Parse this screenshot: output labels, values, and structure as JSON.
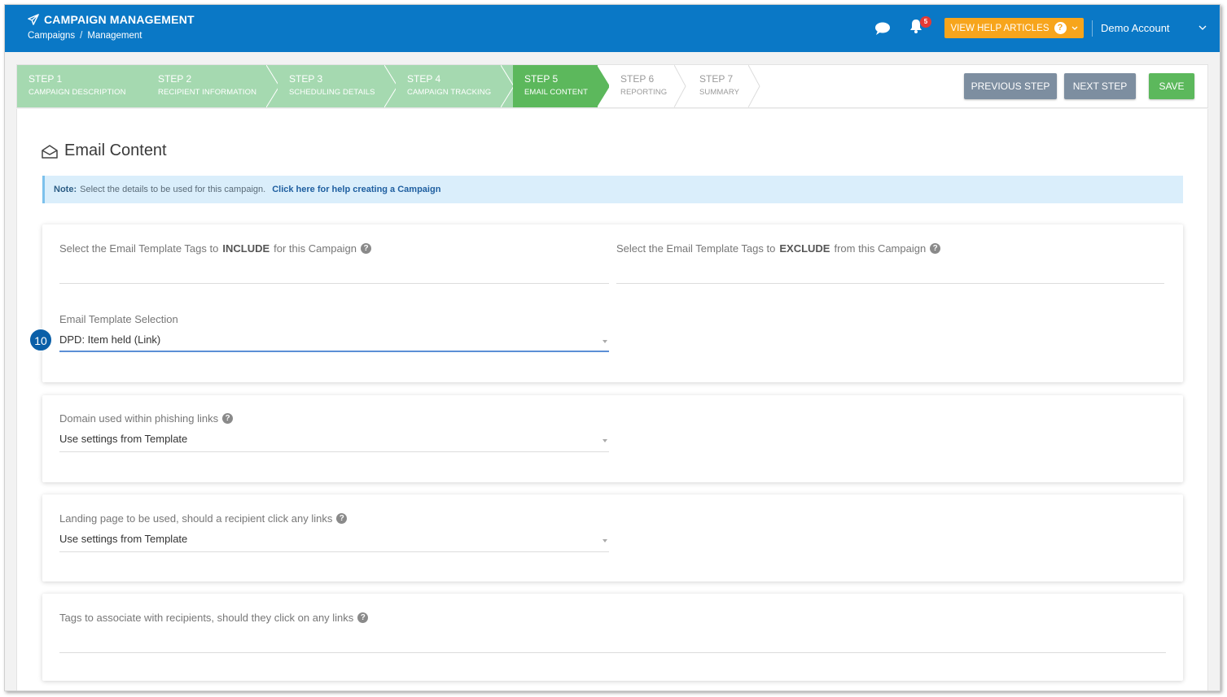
{
  "header": {
    "title": "CAMPAIGN MANAGEMENT",
    "breadcrumb": [
      "Campaigns",
      "Management"
    ],
    "breadcrumb_sep": "/",
    "notification_count": "5",
    "help_button": "VIEW HELP ARTICLES",
    "help_q": "?",
    "account_name": "Demo Account",
    "account_chevron": "⌄",
    "colors": {
      "bar": "#0a78c6",
      "help": "#f7a51c",
      "badge": "#e53935"
    }
  },
  "steps": [
    {
      "num": "STEP 1",
      "label": "CAMPAIGN DESCRIPTION",
      "state": "done"
    },
    {
      "num": "STEP 2",
      "label": "RECIPIENT INFORMATION",
      "state": "done"
    },
    {
      "num": "STEP 3",
      "label": "SCHEDULING DETAILS",
      "state": "done"
    },
    {
      "num": "STEP 4",
      "label": "CAMPAIGN TRACKING",
      "state": "done"
    },
    {
      "num": "STEP 5",
      "label": "EMAIL CONTENT",
      "state": "active"
    },
    {
      "num": "STEP 6",
      "label": "REPORTING",
      "state": "todo"
    },
    {
      "num": "STEP 7",
      "label": "SUMMARY",
      "state": "todo"
    }
  ],
  "actions": {
    "previous": "PREVIOUS STEP",
    "next": "NEXT STEP",
    "save": "SAVE"
  },
  "page": {
    "title": "Email Content",
    "note_label": "Note:",
    "note_text": "Select the details to be used for this campaign.",
    "note_link": "Click here for help creating a Campaign"
  },
  "tags": {
    "include_pre": "Select the Email Template Tags to",
    "include_bold": "INCLUDE",
    "include_post": "for this Campaign",
    "exclude_pre": "Select the Email Template Tags to",
    "exclude_bold": "EXCLUDE",
    "exclude_post": "from this Campaign"
  },
  "template": {
    "label": "Email Template Selection",
    "value": "DPD: Item held (Link)",
    "marker": "10"
  },
  "domain": {
    "label": "Domain used within phishing links",
    "value": "Use settings from Template"
  },
  "landing": {
    "label": "Landing page to be used, should a recipient click any links",
    "value": "Use settings from Template"
  },
  "recipient_tags": {
    "label": "Tags to associate with recipients, should they click on any links"
  },
  "help_glyph": "?"
}
